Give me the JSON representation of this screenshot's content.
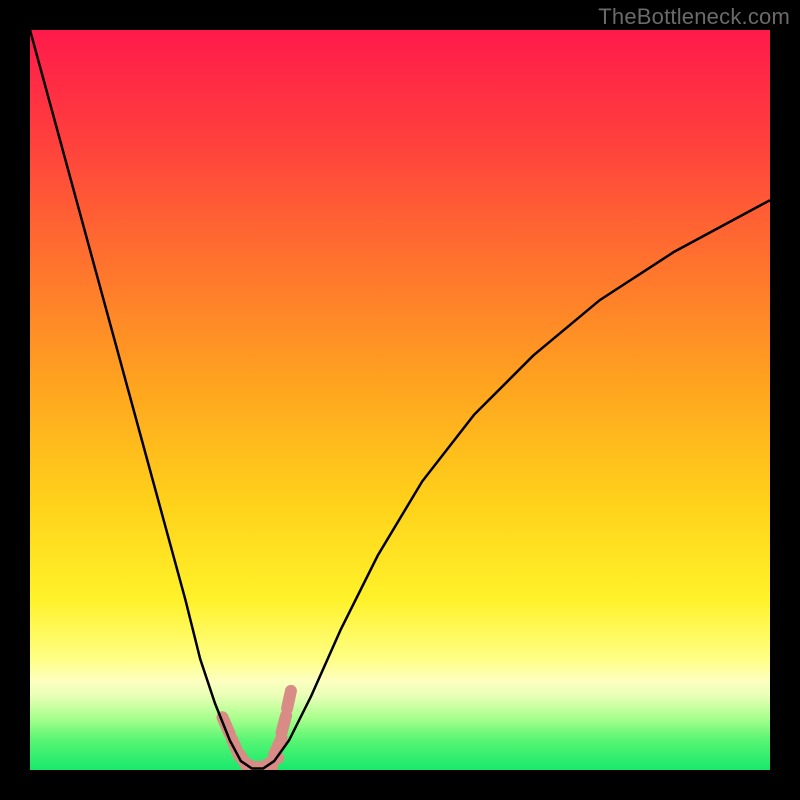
{
  "watermark": "TheBottleneck.com",
  "chart_data": {
    "type": "line",
    "title": "",
    "xlabel": "",
    "ylabel": "",
    "xlim": [
      0,
      100
    ],
    "ylim": [
      0,
      100
    ],
    "grid": false,
    "legend": false,
    "background": {
      "kind": "vertical-gradient",
      "stops": [
        {
          "pct": 0,
          "color": "#ff1a4b"
        },
        {
          "pct": 14,
          "color": "#ff3d3e"
        },
        {
          "pct": 30,
          "color": "#ff6e2f"
        },
        {
          "pct": 48,
          "color": "#ffa41f"
        },
        {
          "pct": 64,
          "color": "#ffd21a"
        },
        {
          "pct": 77,
          "color": "#fff22a"
        },
        {
          "pct": 85,
          "color": "#ffff85"
        },
        {
          "pct": 88,
          "color": "#fdffc1"
        },
        {
          "pct": 90,
          "color": "#e8ffb6"
        },
        {
          "pct": 93,
          "color": "#a8ff8d"
        },
        {
          "pct": 96,
          "color": "#57f573"
        },
        {
          "pct": 100,
          "color": "#18e86c"
        }
      ]
    },
    "series": [
      {
        "name": "bottleneck-curve",
        "color": "#000000",
        "thickness": 2.5,
        "x": [
          0,
          3,
          6,
          9,
          12,
          15,
          18,
          21,
          23,
          25,
          27,
          28.5,
          30,
          31.5,
          33,
          35,
          38,
          42,
          47,
          53,
          60,
          68,
          77,
          87,
          100
        ],
        "y": [
          100,
          89,
          78,
          67,
          56,
          45,
          34,
          23,
          15,
          9,
          4,
          1.2,
          0.2,
          0.2,
          1.2,
          4,
          10,
          19,
          29,
          39,
          48,
          56,
          63.5,
          70,
          77
        ]
      },
      {
        "name": "marker-band",
        "color": "#d98b85",
        "thickness": 12,
        "style": "dotted",
        "x": [
          26.5,
          27.8,
          29.0,
          30.2,
          31.5,
          32.5,
          33.5,
          34.3,
          35.0
        ],
        "y": [
          6.0,
          3.0,
          1.0,
          0.4,
          0.4,
          1.0,
          3.2,
          6.2,
          9.5
        ]
      }
    ]
  }
}
